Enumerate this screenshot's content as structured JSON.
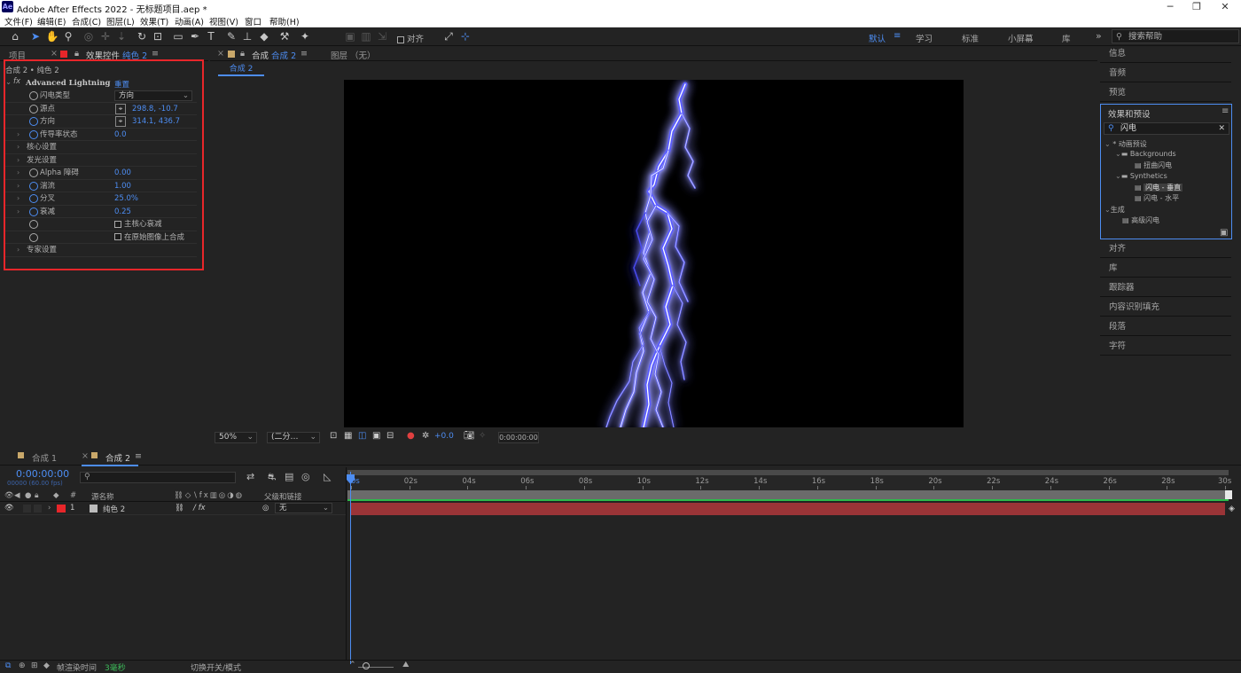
{
  "window": {
    "title": "Adobe After Effects 2022 - 无标题项目.aep *",
    "logo": "Ae"
  },
  "menu": [
    "文件(F)",
    "编辑(E)",
    "合成(C)",
    "图层(L)",
    "效果(T)",
    "动画(A)",
    "视图(V)",
    "窗口",
    "帮助(H)"
  ],
  "toolbar": {
    "align_label": "对齐",
    "search_placeholder": "搜索帮助"
  },
  "workspaces": [
    "默认",
    "学习",
    "标准",
    "小屏幕",
    "库"
  ],
  "left": {
    "tab_project": "项目",
    "tab_fx": "效果控件",
    "tab_fx_layer": "纯色 2",
    "breadcrumb": "合成 2 • 纯色 2",
    "effect_name": "Advanced Lightning",
    "reset": "重置",
    "rows": [
      {
        "label": "闪电类型",
        "value": "方向"
      },
      {
        "label": "源点",
        "value": "298.8, -10.7"
      },
      {
        "label": "方向",
        "value": "314.1, 436.7"
      },
      {
        "label": "传导率状态",
        "value": "0.0"
      },
      {
        "label": "核心设置",
        "value": ""
      },
      {
        "label": "发光设置",
        "value": ""
      },
      {
        "label": "Alpha 障碍",
        "value": "0.00"
      },
      {
        "label": "湍流",
        "value": "1.00"
      },
      {
        "label": "分叉",
        "value": "25.0%"
      },
      {
        "label": "衰减",
        "value": "0.25"
      },
      {
        "label": "主核心衰减",
        "value": ""
      },
      {
        "label": "在原始图像上合成",
        "value": ""
      },
      {
        "label": "专家设置",
        "value": ""
      }
    ]
  },
  "comp": {
    "tab": "合成",
    "tab_name": "合成 2",
    "layer_tab": "图层 （无）",
    "sub_tab": "合成 2"
  },
  "viewer_bar": {
    "zoom": "50%",
    "res": "(二分…",
    "exposure": "+0.0",
    "timecode": "0:00:00:00"
  },
  "right": {
    "panels_top": [
      "信息",
      "音频",
      "预览"
    ],
    "effects_title": "效果和预设",
    "effects_search": "闪电",
    "tree": [
      "* 动画预设",
      "Backgrounds",
      "扭曲闪电",
      "Synthetics",
      "闪电 - 垂直",
      "闪电 - 水平",
      "生成",
      "高级闪电"
    ],
    "panels_bottom": [
      "对齐",
      "库",
      "跟踪器",
      "内容识别填充",
      "段落",
      "字符"
    ]
  },
  "timeline": {
    "tabs": [
      "合成 1",
      "合成 2"
    ],
    "timecode": "0:00:00:00",
    "fps": "00000 (60.00 fps)",
    "col_source": "源名称",
    "col_parent": "父级和链接",
    "col_num": "#",
    "layer": {
      "num": "1",
      "name": "纯色 2",
      "parent": "无"
    },
    "ruler": [
      "0s",
      "02s",
      "04s",
      "06s",
      "08s",
      "10s",
      "12s",
      "14s",
      "16s",
      "18s",
      "20s",
      "22s",
      "24s",
      "26s",
      "28s",
      "30s"
    ],
    "footer_label": "帧渲染时间",
    "footer_value": "3毫秒",
    "footer_toggle": "切换开关/模式"
  }
}
